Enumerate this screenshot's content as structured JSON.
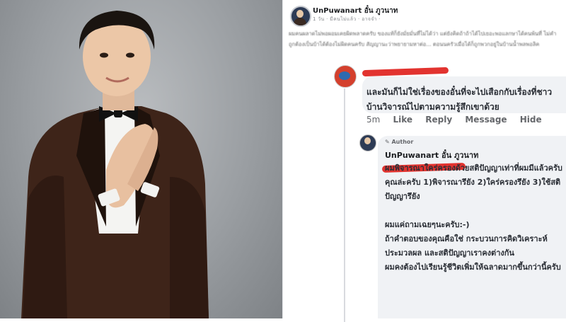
{
  "post": {
    "author": "UnPuwanart อั๋น ภูวนาท",
    "meta": "1 วัน · มีคนไม่แล้ว · อาจจำ · ",
    "text": "ผมคนผลาดไม่พอผอมเคยผิดพลาดครับ ของแท้ก็ยังมั่ยมั่นที่ไม่ได้ว่า แต่ยังคิดถ้าถ้าได้ไปเยอะพอแลกษาได้คนพ้นที่ ไม่คำถูกต้องเป็นบ้าได้ต้องไม่ผิดคนครับ สัญญานะว่าพยายามหาต่อ... ตอนนครัวเมื่อได้ก็ถูกพวกอยู่ในบ้านน้ำพลพอลิค"
  },
  "comment": {
    "text": "และมันก็ไม่ใช่เรื่องของอั๋นที่จะไปเสือกกับเรื่องที่ชาวบ้านวิจารณ์ไปตามความรู้สึกเขาด้วย",
    "time": "5m",
    "actions": [
      "Like",
      "Reply",
      "Message",
      "Hide"
    ]
  },
  "reply": {
    "badge": "✎ Author",
    "author": "UnPuwanart อั๋น ภูวนาท",
    "lines": [
      "ผมพิจารณาใคร่ครองด้วยสติปัญญาเท่าที่ผมมีแล้วครับ  คุณล่ะครับ 1)พิจารณารึยัง 2)ใคร่ครองรึยัง 3)ใช้สติปัญญารึยัง",
      "",
      "ผมแค่ถามเฉยๆนะครับ:-)",
      "ถ้าคำตอบของคุณคือใช่  กระบวนการคิดวิเคราะห์ ประมวลผล และสติปัญญาเราคงต่างกัน",
      "ผมคงต้องไปเรียนรู้ชีวิตเพิ่มให้ฉลาดมากขึ้นกว่านี้ครับ"
    ]
  }
}
